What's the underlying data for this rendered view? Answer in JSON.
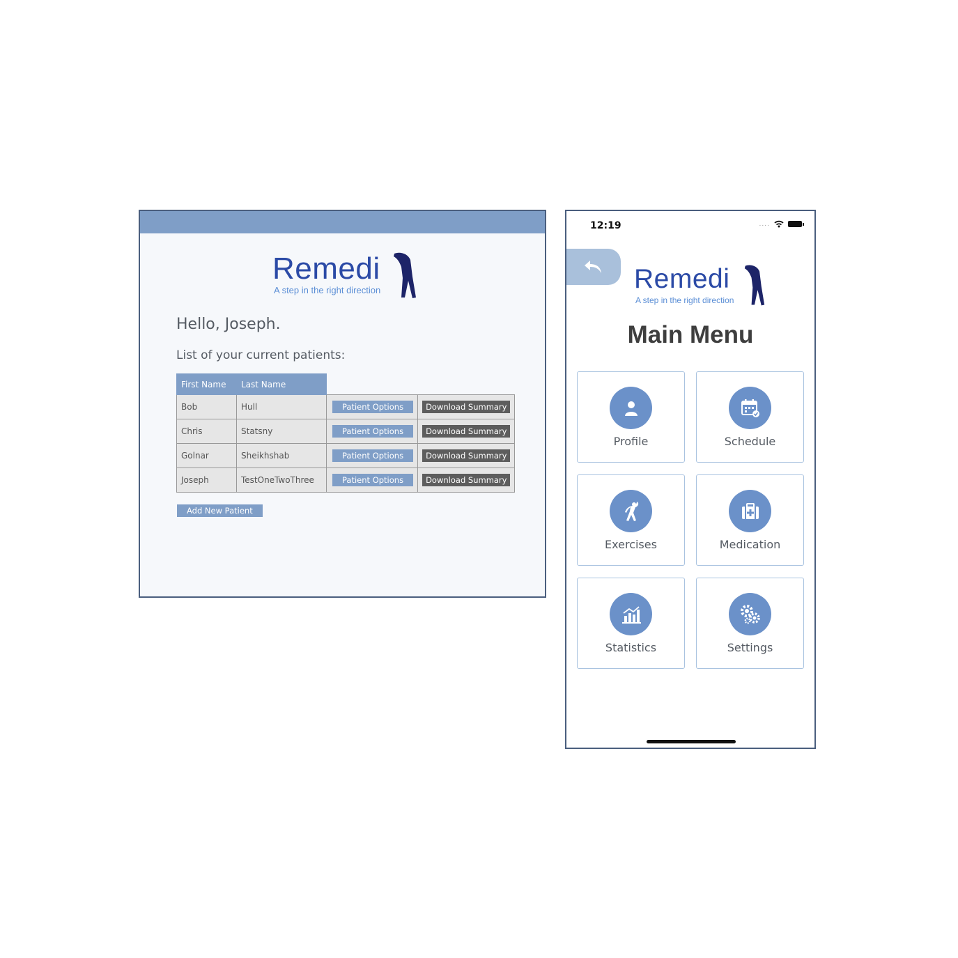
{
  "brand": {
    "name": "Remedi",
    "tagline": "A step in the right direction",
    "word_color": "#2b4aa6",
    "tagline_color": "#5c8fd6",
    "figure_color": "#1d2468"
  },
  "desktop": {
    "greeting": "Hello, Joseph.",
    "list_label": "List of your current patients:",
    "columns": [
      "First Name",
      "Last Name"
    ],
    "patients": [
      {
        "first": "Bob",
        "last": "Hull"
      },
      {
        "first": "Chris",
        "last": "Statsny"
      },
      {
        "first": "Golnar",
        "last": "Sheikhshab"
      },
      {
        "first": "Joseph",
        "last": "TestOneTwoThree"
      }
    ],
    "patient_options_label": "Patient Options",
    "download_summary_label": "Download Summary",
    "add_patient_label": "Add New Patient",
    "accent_color": "#7f9ec7"
  },
  "phone": {
    "status_time": "12:19",
    "back_icon": "back-arrow-icon",
    "title": "Main Menu",
    "tiles": [
      {
        "label": "Profile",
        "icon": "person-icon"
      },
      {
        "label": "Schedule",
        "icon": "calendar-icon"
      },
      {
        "label": "Exercises",
        "icon": "stretch-icon"
      },
      {
        "label": "Medication",
        "icon": "first-aid-kit-icon"
      },
      {
        "label": "Statistics",
        "icon": "bar-chart-icon"
      },
      {
        "label": "Settings",
        "icon": "gears-icon"
      }
    ],
    "tile_icon_color": "#6b91c9"
  }
}
